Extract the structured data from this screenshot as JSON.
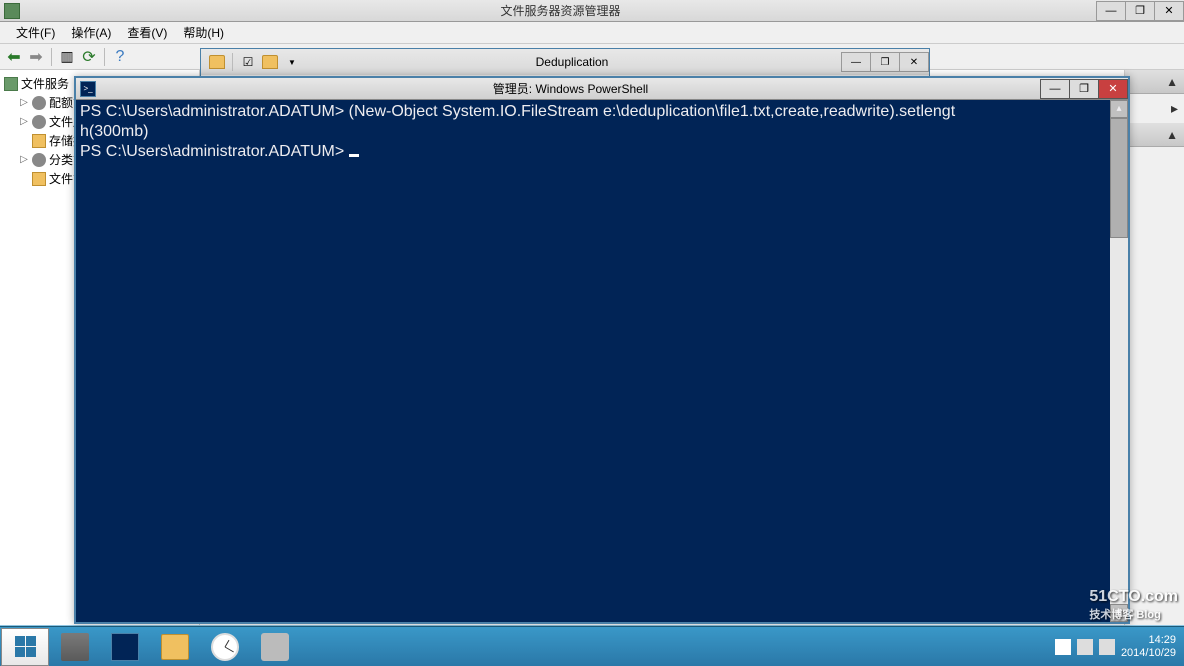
{
  "mmc": {
    "title": "文件服务器资源管理器",
    "menu": [
      "文件(F)",
      "操作(A)",
      "查看(V)",
      "帮助(H)"
    ],
    "win_btns": {
      "min": "—",
      "max": "❐",
      "close": "✕"
    },
    "tree": {
      "root": "文件服务",
      "children": [
        "配额管",
        "文件屏",
        "存储报",
        "分类管",
        "文件管"
      ]
    }
  },
  "explorer": {
    "title": "Deduplication",
    "win_btns": {
      "min": "—",
      "max": "❐",
      "close": "✕"
    }
  },
  "powershell": {
    "title": "管理员: Windows PowerShell",
    "win_btns": {
      "min": "—",
      "max": "❐",
      "close": "✕"
    },
    "prompt": "PS C:\\Users\\administrator.ADATUM>",
    "line1_cmd": "(New-Object System.IO.FileStream e:\\deduplication\\file1.txt,create,readwrite).setlengt",
    "line2": "h(300mb)"
  },
  "taskbar": {
    "time": "14:29",
    "date": "2014/10/29"
  },
  "watermark": {
    "main": "51CTO.com",
    "sub": "技术博客  Blog"
  }
}
